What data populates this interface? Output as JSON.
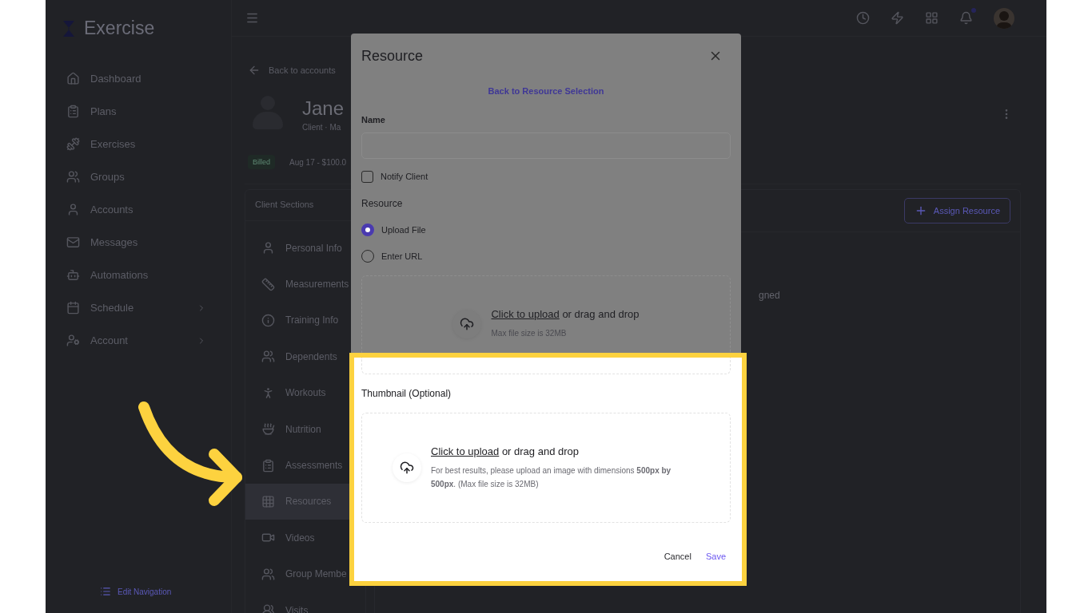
{
  "sidebar": {
    "logo": "Exercise",
    "items": [
      {
        "label": "Dashboard",
        "expandable": false
      },
      {
        "label": "Plans",
        "expandable": false
      },
      {
        "label": "Exercises",
        "expandable": false
      },
      {
        "label": "Groups",
        "expandable": false
      },
      {
        "label": "Accounts",
        "expandable": false
      },
      {
        "label": "Messages",
        "expandable": false
      },
      {
        "label": "Automations",
        "expandable": false
      },
      {
        "label": "Schedule",
        "expandable": true
      },
      {
        "label": "Account",
        "expandable": true
      }
    ],
    "footer": "Edit Navigation"
  },
  "topbar": {
    "notification_dot": true
  },
  "page": {
    "back_link": "Back to accounts",
    "client_name": "Jane",
    "client_meta": "Client · Ma",
    "billing_badge": "Billed",
    "billing_info": "Aug 17 - $100.0",
    "sections_title": "Client Sections",
    "sections": [
      {
        "label": "Personal Info",
        "selected": false
      },
      {
        "label": "Measurements",
        "selected": false
      },
      {
        "label": "Training Info",
        "selected": false
      },
      {
        "label": "Dependents",
        "selected": false
      },
      {
        "label": "Workouts",
        "selected": false
      },
      {
        "label": "Nutrition",
        "selected": false
      },
      {
        "label": "Assessments",
        "selected": false
      },
      {
        "label": "Resources",
        "selected": true
      },
      {
        "label": "Videos",
        "selected": false
      },
      {
        "label": "Group Membe",
        "selected": false
      },
      {
        "label": "Visits",
        "selected": false
      }
    ],
    "assign_button": "Assign Resource",
    "empty_text": "gned"
  },
  "dialog": {
    "title": "Resource",
    "back_link": "Back to Resource Selection",
    "name_label": "Name",
    "notify": {
      "label": "Notify Client",
      "checked": false
    },
    "resource_label": "Resource",
    "options": [
      {
        "label": "Upload File",
        "selected": true
      },
      {
        "label": "Enter URL",
        "selected": false
      }
    ],
    "upload": {
      "link": "Click to upload",
      "rest": " or drag and drop",
      "hint": "Max file size is 32MB"
    },
    "thumbnail_label": "Thumbnail (Optional)",
    "thumbnail_upload": {
      "link": "Click to upload",
      "rest": " or drag and drop",
      "hint": "For best results, please upload an image with dimensions **500px by 500px**. (Max file size is 32MB)"
    },
    "buttons": [
      {
        "label": "Cancel",
        "kind": "secondary"
      },
      {
        "label": "Save",
        "kind": "primary"
      }
    ]
  }
}
